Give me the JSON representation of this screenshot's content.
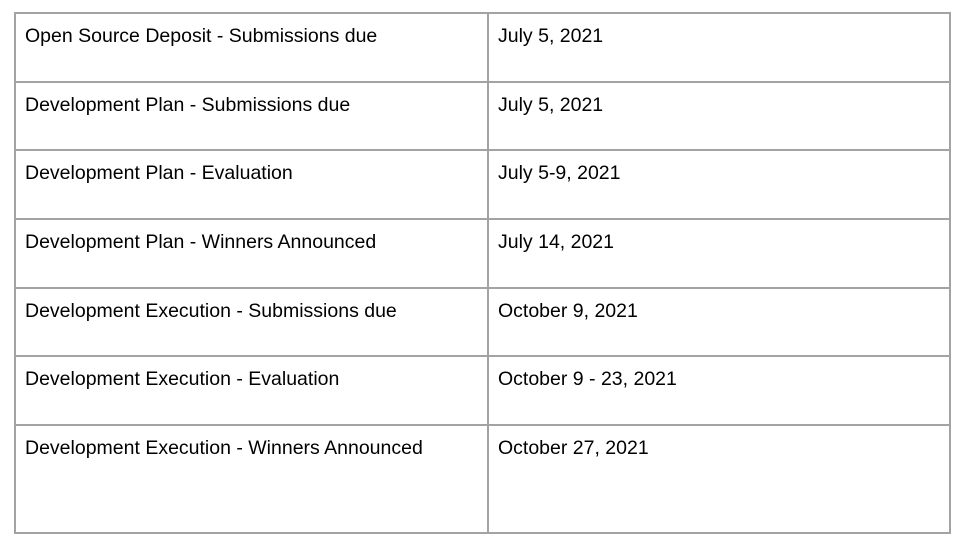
{
  "rows": [
    {
      "event": "Open Source Deposit - Submissions due",
      "date": "July 5, 2021"
    },
    {
      "event": "Development Plan - Submissions due",
      "date": "July 5, 2021"
    },
    {
      "event": "Development Plan - Evaluation",
      "date": "July 5-9, 2021"
    },
    {
      "event": "Development Plan - Winners Announced",
      "date": "July 14, 2021"
    },
    {
      "event": "Development Execution - Submissions due",
      "date": "October 9, 2021"
    },
    {
      "event": "Development Execution - Evaluation",
      "date": "October 9 - 23, 2021"
    },
    {
      "event": "Development Execution - Winners Announced",
      "date": "October 27, 2021"
    }
  ]
}
